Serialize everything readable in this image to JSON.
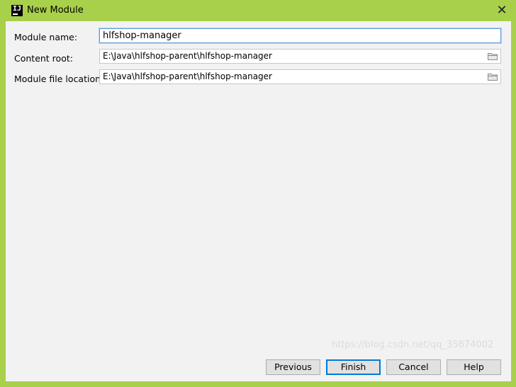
{
  "window": {
    "title": "New Module",
    "app_icon_letters": "IJ",
    "close_glyph": "✕",
    "accent_color": "#a8d04a"
  },
  "form": {
    "module_name_label": "Module name:",
    "module_name_value": "hlfshop-manager",
    "content_root_label": "Content root:",
    "content_root_value": "E:\\Java\\hlfshop-parent\\hlfshop-manager",
    "module_file_location_label": "Module file location:",
    "module_file_location_value": "E:\\Java\\hlfshop-parent\\hlfshop-manager",
    "browse_icon": "folder-icon"
  },
  "buttons": {
    "previous": "Previous",
    "finish": "Finish",
    "cancel": "Cancel",
    "help": "Help"
  },
  "watermark": "https://blog.csdn.net/qq_35874002"
}
